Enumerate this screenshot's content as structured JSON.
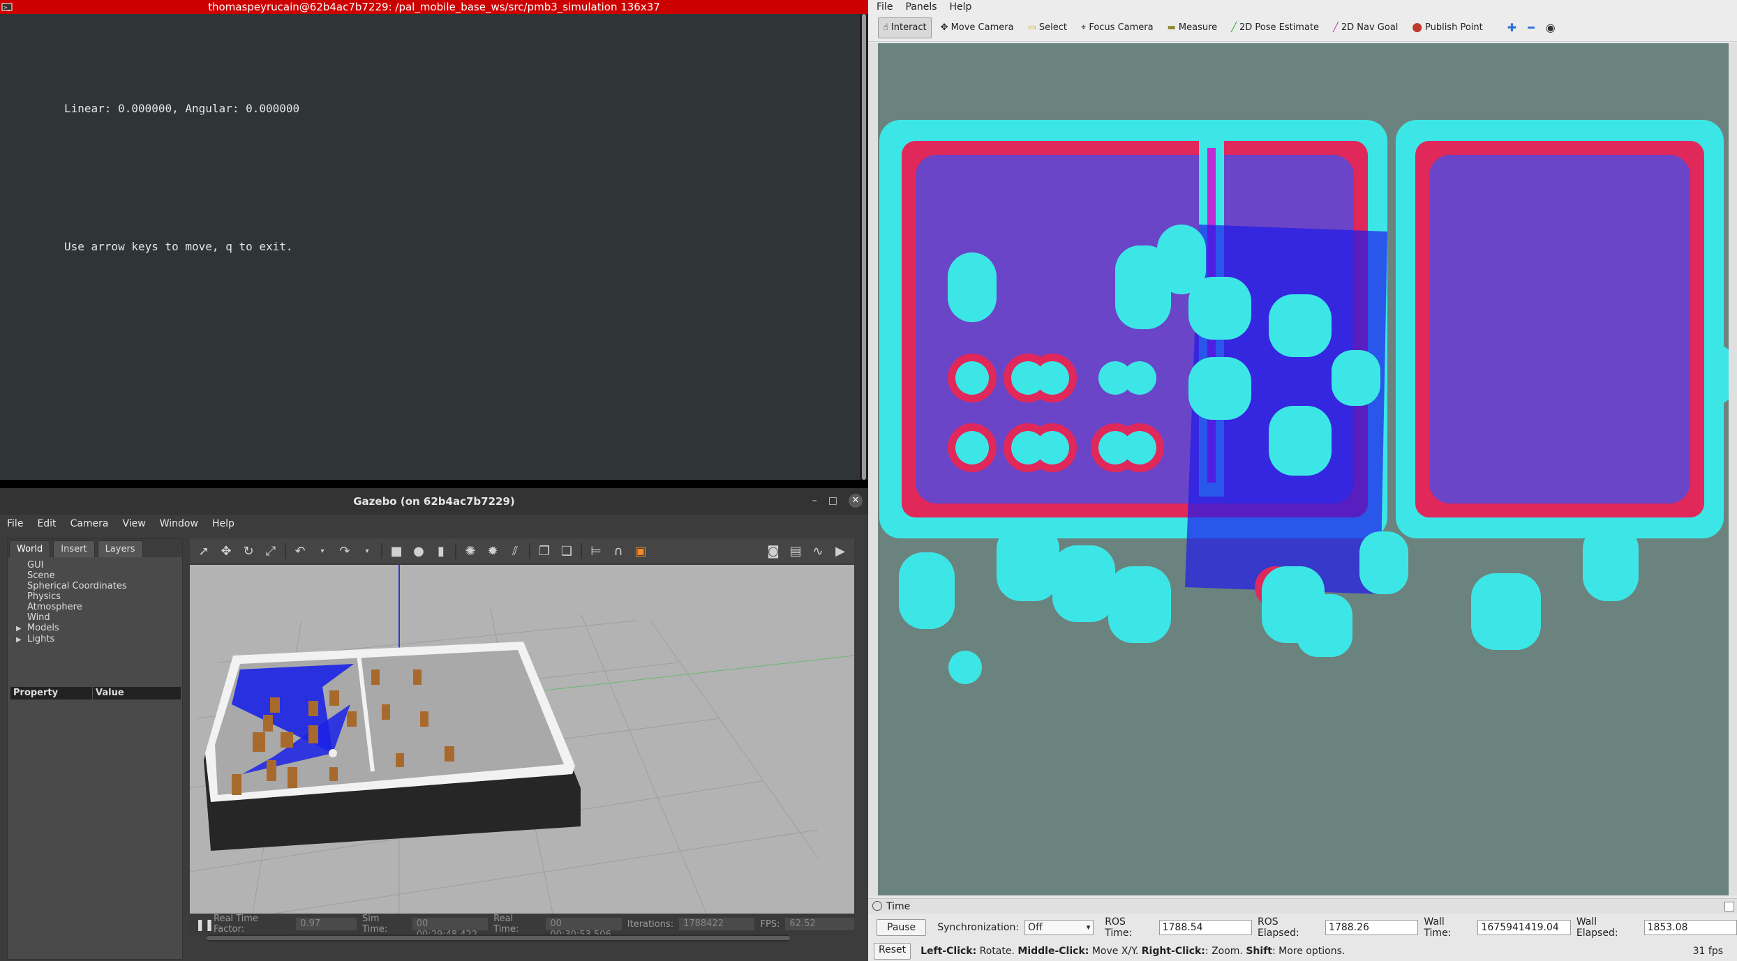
{
  "terminal": {
    "title": "thomaspeyrucain@62b4ac7b7229: /pal_mobile_base_ws/src/pmb3_simulation 136x37",
    "line1": "Linear: 0.000000, Angular: 0.000000",
    "line2": "Use arrow keys to move, q to exit."
  },
  "gazebo": {
    "title": "Gazebo (on 62b4ac7b7229)",
    "menu": [
      "File",
      "Edit",
      "Camera",
      "View",
      "Window",
      "Help"
    ],
    "tabs": [
      "World",
      "Insert",
      "Layers"
    ],
    "tree": [
      "GUI",
      "Scene",
      "Spherical Coordinates",
      "Physics",
      "Atmosphere",
      "Wind",
      "Models",
      "Lights"
    ],
    "prop_headers": [
      "Property",
      "Value"
    ],
    "status": {
      "rtf_label": "Real Time Factor:",
      "rtf": "0.97",
      "sim_label": "Sim Time:",
      "sim": "00 00:29:48.422",
      "real_label": "Real Time:",
      "real": "00 00:30:53.506",
      "iter_label": "Iterations:",
      "iter": "1788422",
      "fps_label": "FPS:",
      "fps": "62.52"
    }
  },
  "rviz": {
    "menu": [
      "File",
      "Panels",
      "Help"
    ],
    "tools": [
      "Interact",
      "Move Camera",
      "Select",
      "Focus Camera",
      "Measure",
      "2D Pose Estimate",
      "2D Nav Goal",
      "Publish Point"
    ],
    "time_panel": {
      "title": "Time",
      "pause": "Pause",
      "sync_label": "Synchronization:",
      "sync": "Off",
      "ros_time_label": "ROS Time:",
      "ros_time": "1788.54",
      "ros_elapsed_label": "ROS Elapsed:",
      "ros_elapsed": "1788.26",
      "wall_time_label": "Wall Time:",
      "wall_time": "1675941419.04",
      "wall_elapsed_label": "Wall Elapsed:",
      "wall_elapsed": "1853.08"
    },
    "status": {
      "reset": "Reset",
      "lclick": "Left-Click:",
      "lclick_desc": "Rotate.",
      "mclick": "Middle-Click:",
      "mclick_desc": "Move X/Y.",
      "rclick": "Right-Click:",
      "rclick_desc": ": Zoom.",
      "shift": "Shift",
      "shift_desc": ": More options.",
      "fps": "31 fps"
    }
  }
}
